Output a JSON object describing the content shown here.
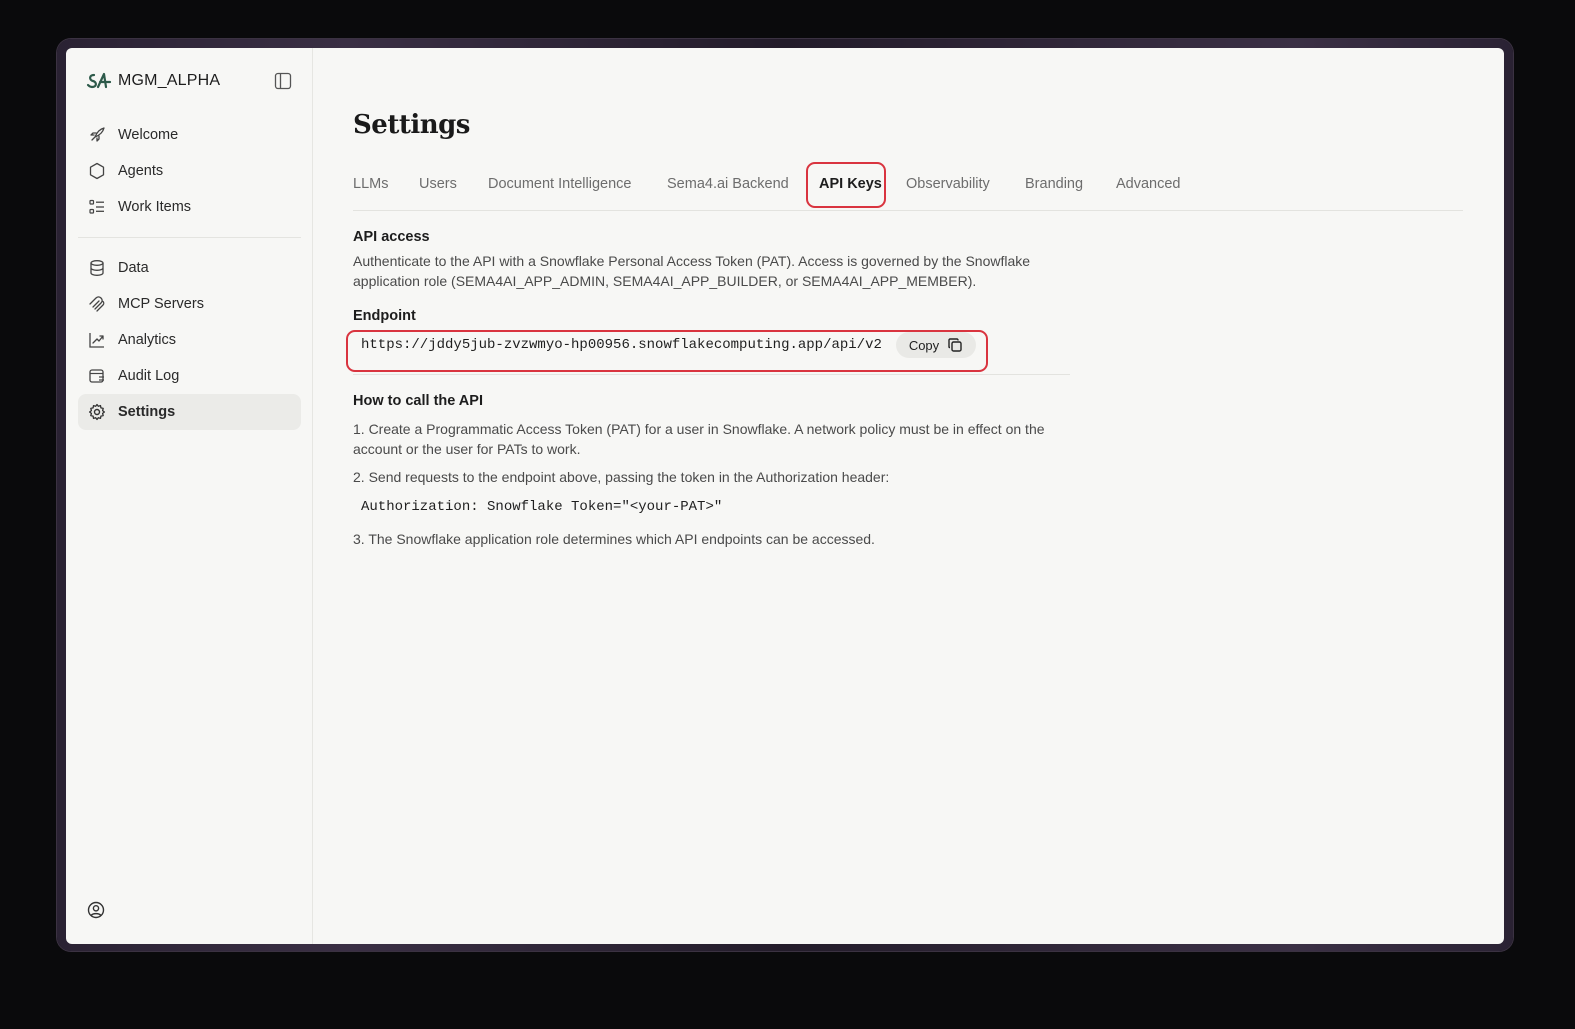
{
  "app": {
    "name": "MGM_ALPHA"
  },
  "sidebar": {
    "items_top": [
      {
        "label": "Welcome",
        "icon": "rocket-icon"
      },
      {
        "label": "Agents",
        "icon": "hexagon-icon"
      },
      {
        "label": "Work Items",
        "icon": "list-icon"
      }
    ],
    "items_bottom": [
      {
        "label": "Data",
        "icon": "database-icon"
      },
      {
        "label": "MCP Servers",
        "icon": "plug-icon"
      },
      {
        "label": "Analytics",
        "icon": "chart-icon"
      },
      {
        "label": "Audit Log",
        "icon": "log-icon"
      },
      {
        "label": "Settings",
        "icon": "gear-icon",
        "active": true
      }
    ]
  },
  "page": {
    "title": "Settings"
  },
  "tabs": [
    {
      "label": "LLMs"
    },
    {
      "label": "Users"
    },
    {
      "label": "Document Intelligence"
    },
    {
      "label": "Sema4.ai Backend"
    },
    {
      "label": "API Keys",
      "active": true
    },
    {
      "label": "Observability"
    },
    {
      "label": "Branding"
    },
    {
      "label": "Advanced"
    }
  ],
  "api_access": {
    "title": "API access",
    "description": "Authenticate to the API with a Snowflake Personal Access Token (PAT). Access is governed by the Snowflake application role (SEMA4AI_APP_ADMIN, SEMA4AI_APP_BUILDER, or SEMA4AI_APP_MEMBER)."
  },
  "endpoint": {
    "label": "Endpoint",
    "url": "https://jddy5jub-zvzwmyo-hp00956.snowflakecomputing.app/api/v2",
    "copy_label": "Copy"
  },
  "how_to": {
    "title": "How to call the API",
    "step1": "1. Create a Programmatic Access Token (PAT) for a user in Snowflake. A network policy must be in effect on the account or the user for PATs to work.",
    "step2": "2. Send requests to the endpoint above, passing the token in the Authorization header:",
    "code": "Authorization: Snowflake Token=\"<your-PAT>\"",
    "step3": "3. The Snowflake application role determines which API endpoints can be accessed."
  },
  "colors": {
    "highlight": "#d9343f",
    "background": "#f7f7f5",
    "brand": "#2d5a4a"
  }
}
